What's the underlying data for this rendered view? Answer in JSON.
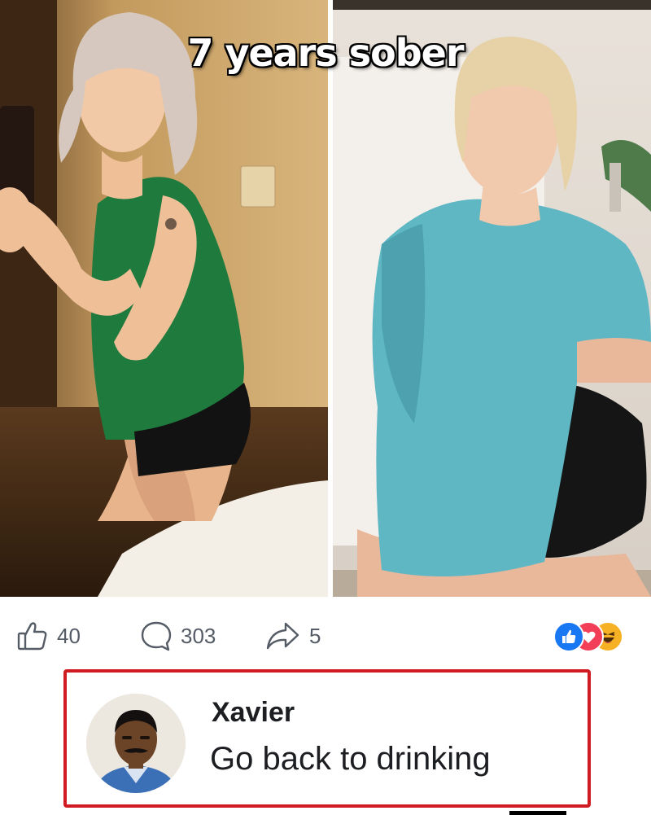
{
  "post": {
    "caption": "7 years sober",
    "photos": [
      {
        "name": "before-photo"
      },
      {
        "name": "after-photo"
      }
    ]
  },
  "actions": {
    "like_count": "40",
    "comment_count": "303",
    "share_count": "5",
    "icons": {
      "like": "thumbs-up-icon",
      "comment": "comment-bubble-icon",
      "share": "share-arrow-icon"
    },
    "color": "#555c66"
  },
  "reactions": [
    {
      "type": "like",
      "icon": "like-reaction-icon",
      "color": "#1877f2"
    },
    {
      "type": "love",
      "icon": "love-reaction-icon",
      "color": "#f33e58"
    },
    {
      "type": "haha",
      "icon": "haha-reaction-icon",
      "color": "#f7b125"
    }
  ],
  "comment": {
    "author": "Xavier",
    "text": "Go back to drinking",
    "highlight_color": "#d01b22"
  }
}
